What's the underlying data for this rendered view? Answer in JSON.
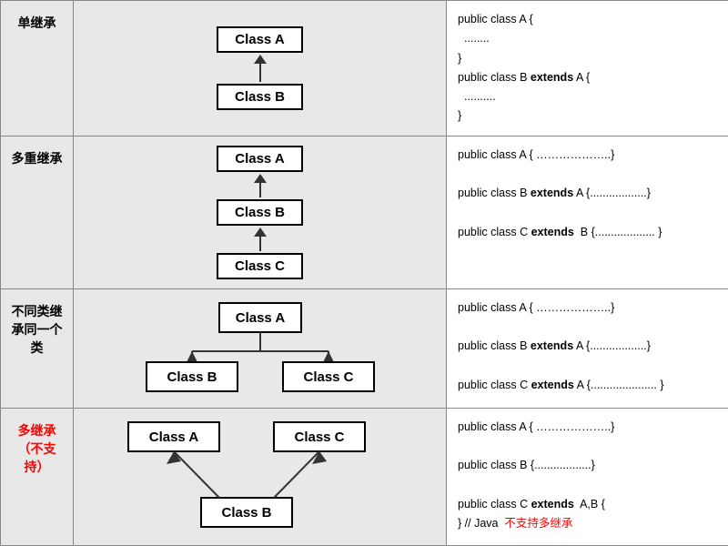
{
  "rows": [
    {
      "id": "single-inheritance",
      "label": "单继承",
      "label_color": "black",
      "diagram_type": "single",
      "code_lines": [
        {
          "parts": [
            {
              "text": "public class A {",
              "bold": false
            }
          ]
        },
        {
          "parts": [
            {
              "text": "  ........",
              "bold": false
            }
          ]
        },
        {
          "parts": [
            {
              "text": "}",
              "bold": false
            }
          ]
        },
        {
          "parts": [
            {
              "text": "public class B ",
              "bold": false
            },
            {
              "text": "extends",
              "bold": true
            },
            {
              "text": " A {",
              "bold": false
            }
          ]
        },
        {
          "parts": [
            {
              "text": "  ..........",
              "bold": false
            }
          ]
        },
        {
          "parts": [
            {
              "text": "}",
              "bold": false
            }
          ]
        }
      ]
    },
    {
      "id": "multi-level-inheritance",
      "label": "多重继承",
      "label_color": "black",
      "diagram_type": "multilevel",
      "code_lines": [
        {
          "parts": [
            {
              "text": "public class A { ………………..}",
              "bold": false
            }
          ]
        },
        {
          "parts": [
            {
              "text": "",
              "bold": false
            }
          ]
        },
        {
          "parts": [
            {
              "text": "public class B ",
              "bold": false
            },
            {
              "text": "extends",
              "bold": true
            },
            {
              "text": " A {..................}",
              "bold": false
            }
          ]
        },
        {
          "parts": [
            {
              "text": "",
              "bold": false
            }
          ]
        },
        {
          "parts": [
            {
              "text": "public class C ",
              "bold": false
            },
            {
              "text": "extends",
              "bold": true
            },
            {
              "text": "  B {................... }",
              "bold": false
            }
          ]
        }
      ]
    },
    {
      "id": "hierarchical-inheritance",
      "label": "不同类继承同一个类",
      "label_color": "black",
      "diagram_type": "hierarchical",
      "code_lines": [
        {
          "parts": [
            {
              "text": "public class A { ………………..}",
              "bold": false
            }
          ]
        },
        {
          "parts": [
            {
              "text": "",
              "bold": false
            }
          ]
        },
        {
          "parts": [
            {
              "text": "public class B ",
              "bold": false
            },
            {
              "text": "extends",
              "bold": true
            },
            {
              "text": " A {..................}",
              "bold": false
            }
          ]
        },
        {
          "parts": [
            {
              "text": "",
              "bold": false
            }
          ]
        },
        {
          "parts": [
            {
              "text": "public class C ",
              "bold": false
            },
            {
              "text": "extends",
              "bold": true
            },
            {
              "text": " A {..................... }",
              "bold": false
            }
          ]
        }
      ]
    },
    {
      "id": "multiple-inheritance",
      "label": "多继承（不支持）",
      "label_color": "red",
      "diagram_type": "multiple",
      "code_lines": [
        {
          "parts": [
            {
              "text": "public class A { ………………..}",
              "bold": false
            }
          ]
        },
        {
          "parts": [
            {
              "text": "",
              "bold": false
            }
          ]
        },
        {
          "parts": [
            {
              "text": "public class B {..................}",
              "bold": false
            }
          ]
        },
        {
          "parts": [
            {
              "text": "",
              "bold": false
            }
          ]
        },
        {
          "parts": [
            {
              "text": "public class C ",
              "bold": false
            },
            {
              "text": "extends",
              "bold": true
            },
            {
              "text": "  A,B {",
              "bold": false
            }
          ]
        },
        {
          "parts": [
            {
              "text": "} // Java  ",
              "bold": false
            },
            {
              "text": "不支持多继承",
              "bold": false,
              "red": true
            }
          ]
        }
      ]
    }
  ]
}
